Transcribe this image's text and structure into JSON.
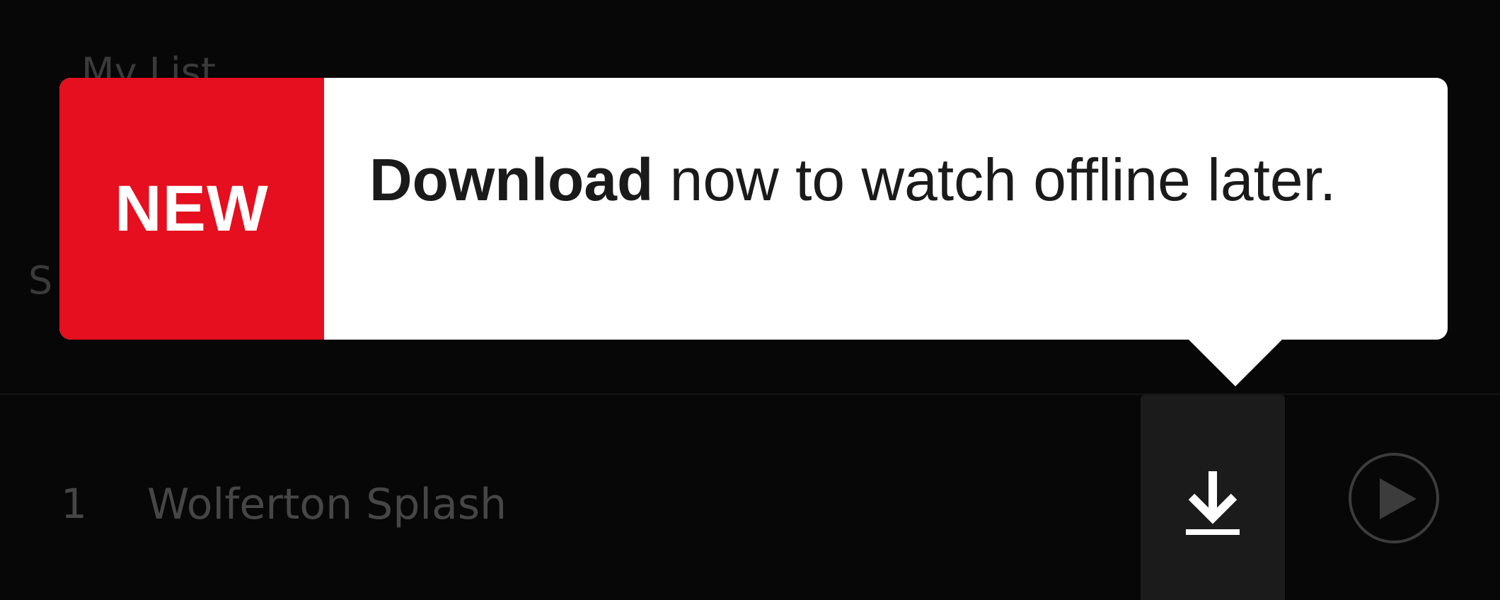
{
  "background": {
    "list_label": "My List",
    "section_label": "S"
  },
  "episode": {
    "number": "1",
    "title": "Wolferton Splash",
    "download_icon": "download-icon",
    "play_icon": "play-circle-icon"
  },
  "tooltip": {
    "badge": "NEW",
    "message_bold": "Download",
    "message_rest": " now to watch offline later."
  },
  "colors": {
    "background": "#070707",
    "badge_red": "#e50f1f",
    "tooltip_bg": "#ffffff",
    "muted_text": "#464646"
  }
}
